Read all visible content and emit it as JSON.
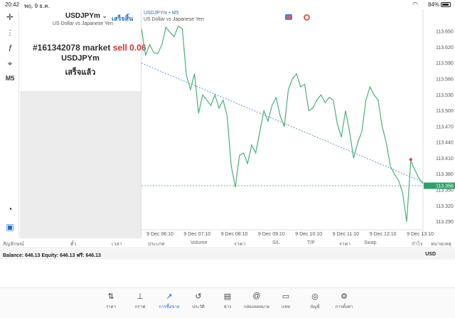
{
  "status_bar": {
    "time": "20:42",
    "date": "พฤ. 9 ธ.ค.",
    "battery": "84%"
  },
  "info_panel": {
    "symbol": "USDJPYm",
    "description": "US Dollar vs Japanese Yen",
    "done_label": "เสร็จสิ้น",
    "order_id": "#161342078 market",
    "order_side": "sell 0.06",
    "order_symbol": "USDJPYm",
    "order_status": "เสร็จแล้ว"
  },
  "chart_header": {
    "label": "USDJPYm • M5",
    "description": "US Dollar vs Japanese Yen"
  },
  "left_toolbar": [
    "crosshair-icon",
    "candles-icon",
    "function-icon",
    "objects-icon",
    "M5",
    "indicator-icon",
    "new-order-icon"
  ],
  "chart_data": {
    "type": "line",
    "price_ticks": [
      "113.650",
      "113.620",
      "113.590",
      "113.560",
      "113.530",
      "113.500",
      "113.470",
      "113.440",
      "113.410",
      "113.380",
      "113.350",
      "113.320",
      "113.290"
    ],
    "current_price": "113.358",
    "time_ticks": [
      "9 Dec 06:10",
      "9 Dec 07:10",
      "9 Dec 08:10",
      "9 Dec 09:10",
      "9 Dec 10:10",
      "9 Dec 11:10",
      "9 Dec 12:10",
      "9 Dec 13:10"
    ],
    "ylim": [
      113.28,
      113.665
    ],
    "series_color": "#4caf7a",
    "trendline_color": "#3a7bd5",
    "prices": [
      113.655,
      113.605,
      113.625,
      113.61,
      113.608,
      113.625,
      113.658,
      113.648,
      113.64,
      113.66,
      113.655,
      113.568,
      113.54,
      113.57,
      113.495,
      113.53,
      113.52,
      113.51,
      113.53,
      113.505,
      113.52,
      113.49,
      113.395,
      113.355,
      113.415,
      113.42,
      113.4,
      113.435,
      113.42,
      113.46,
      113.5,
      113.48,
      113.51,
      113.525,
      113.49,
      113.47,
      113.54,
      113.56,
      113.57,
      113.545,
      113.55,
      113.5,
      113.505,
      113.52,
      113.53,
      113.515,
      113.525,
      113.52,
      113.475,
      113.45,
      113.5,
      113.46,
      113.41,
      113.44,
      113.46,
      113.52,
      113.545,
      113.53,
      113.52,
      113.47,
      113.44,
      113.395,
      113.38,
      113.368,
      113.345,
      113.29,
      113.405,
      113.388,
      113.372,
      113.362
    ],
    "trendline": {
      "start": 113.59,
      "end": 113.365
    }
  },
  "table_headers": [
    "สัญลักษณ์",
    "ตั๋ว",
    "เวลา",
    "ประเภท",
    "Volume",
    "ราคา",
    "S/L",
    "T/P",
    "ราคา",
    "Swap",
    "กำไร",
    "หมายเหตุ"
  ],
  "balance_bar": {
    "text": "Balance: 646.13 Equity: 646.13 ฟรี: 646.13",
    "currency": "USD"
  },
  "tabs": [
    {
      "icon": "⇅",
      "label": "ราคา"
    },
    {
      "icon": "⊥",
      "label": "กราฟ"
    },
    {
      "icon": "↗",
      "label": "การซื้อขาย",
      "active": true
    },
    {
      "icon": "↺",
      "label": "ประวัติ"
    },
    {
      "icon": "▤",
      "label": "ข่าว"
    },
    {
      "icon": "@",
      "label": "กล่องจดหมาย"
    },
    {
      "icon": "▭",
      "label": "แชท"
    },
    {
      "icon": "◎",
      "label": "บัญชี"
    },
    {
      "icon": "⚙",
      "label": "การตั้งค่า"
    }
  ]
}
